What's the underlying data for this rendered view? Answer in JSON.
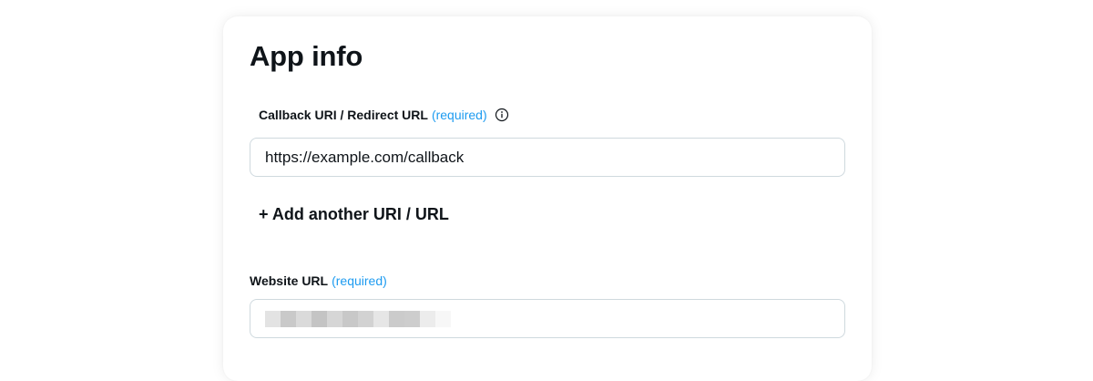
{
  "app_info": {
    "title": "App info",
    "callback": {
      "label": "Callback URI / Redirect URL",
      "required_text": "(required)",
      "value": "https://example.com/callback",
      "info_icon": "info-circle-icon"
    },
    "add_link": "+ Add another URI / URL",
    "website": {
      "label": "Website URL",
      "required_text": "(required)"
    }
  },
  "colors": {
    "accent": "#1d9bf0",
    "text": "#0f1419",
    "border": "#cfd9de"
  }
}
